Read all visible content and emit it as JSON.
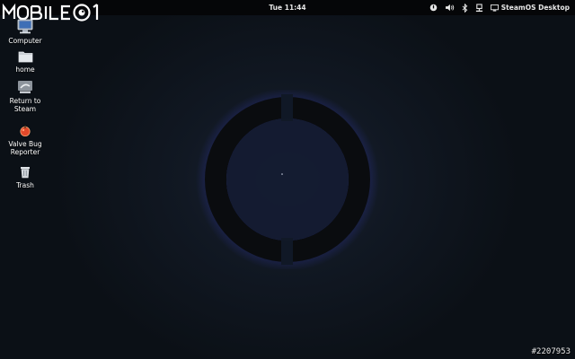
{
  "watermark": {
    "brand": "MOBILE01"
  },
  "topbar": {
    "clock": "Tue 11:44",
    "session_label": "SteamOS Desktop"
  },
  "desktop_icons": [
    {
      "label": "Computer"
    },
    {
      "label": "home"
    },
    {
      "label": "Return to Steam"
    },
    {
      "label": "Valve Bug Reporter"
    },
    {
      "label": "Trash"
    }
  ],
  "image_id": "#2207953",
  "colors": {
    "background": "#0c1015",
    "topbar": "#050608",
    "ring": "#0a0c0f",
    "ring_glow": "#3a3fc8"
  }
}
